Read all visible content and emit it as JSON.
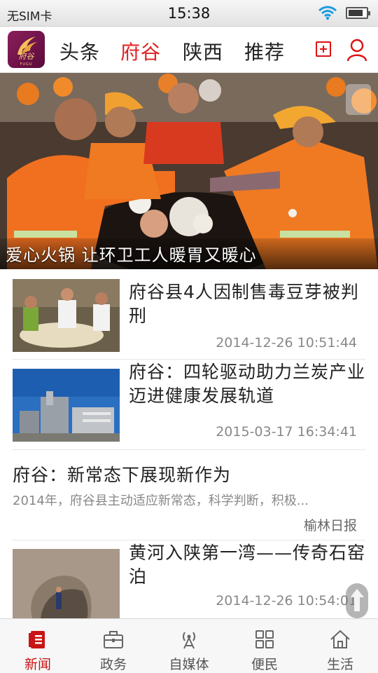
{
  "status_bar": {
    "carrier": "无SIM卡",
    "time": "15:38",
    "battery_level": 0.85
  },
  "header": {
    "logo_text": "府谷",
    "logo_sub": "FUGU",
    "tabs": [
      {
        "label": "头条",
        "active": false
      },
      {
        "label": "府谷",
        "active": true
      },
      {
        "label": "陕西",
        "active": false
      },
      {
        "label": "推荐",
        "active": false
      }
    ],
    "add_icon": "plus-box-icon",
    "user_icon": "user-icon"
  },
  "hero": {
    "caption": "爱心火锅 让环卫工人暖胃又暖心"
  },
  "news": [
    {
      "title": "府谷县4人因制售毒豆芽被判刑",
      "time": "2014-12-26 10:51:44",
      "thumb_icon": "photo-workers-sprouts"
    },
    {
      "title": "府谷：四轮驱动助力兰炭产业迈进健康发展轨道",
      "time": "2015-03-17 16:34:41",
      "thumb_icon": "photo-factory"
    },
    {
      "title": "府谷：新常态下展现新作为",
      "summary": "2014年，府谷县主动适应新常态，科学判断，积极...",
      "source": "榆林日报"
    },
    {
      "title": "黄河入陕第一湾——传奇石窑泊",
      "time": "2014-12-26 10:54:01",
      "thumb_icon": "photo-cave"
    }
  ],
  "bottom_nav": [
    {
      "label": "新闻",
      "icon": "news-icon",
      "active": true
    },
    {
      "label": "政务",
      "icon": "briefcase-icon",
      "active": false
    },
    {
      "label": "自媒体",
      "icon": "antenna-icon",
      "active": false
    },
    {
      "label": "便民",
      "icon": "grid-icon",
      "active": false
    },
    {
      "label": "生活",
      "icon": "home-icon",
      "active": false
    }
  ],
  "colors": {
    "accent": "#e02020",
    "tab_active": "#e02020",
    "nav_active": "#c81414"
  }
}
